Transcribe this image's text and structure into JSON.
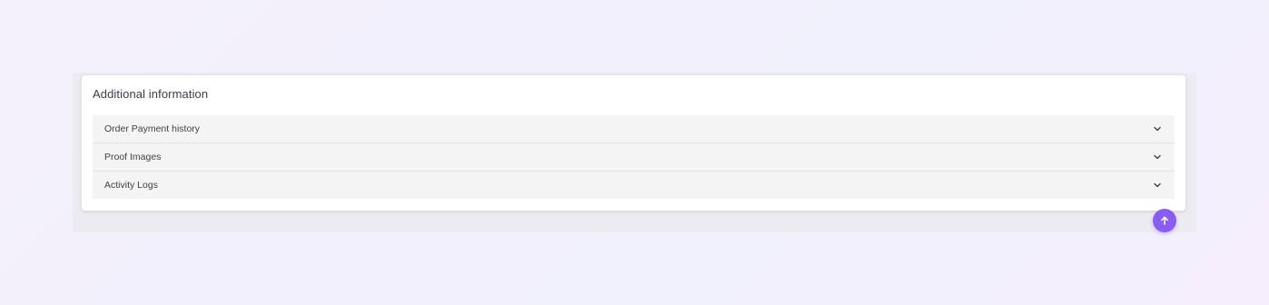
{
  "card": {
    "title": "Additional information"
  },
  "accordion": {
    "items": [
      {
        "label": "Order Payment history",
        "icon": "chevron-down-icon"
      },
      {
        "label": "Proof Images",
        "icon": "chevron-down-icon"
      },
      {
        "label": "Activity Logs",
        "icon": "chevron-down-icon"
      }
    ]
  },
  "scroll_top": {
    "icon": "arrow-up-icon",
    "color": "#8a5cf0"
  }
}
